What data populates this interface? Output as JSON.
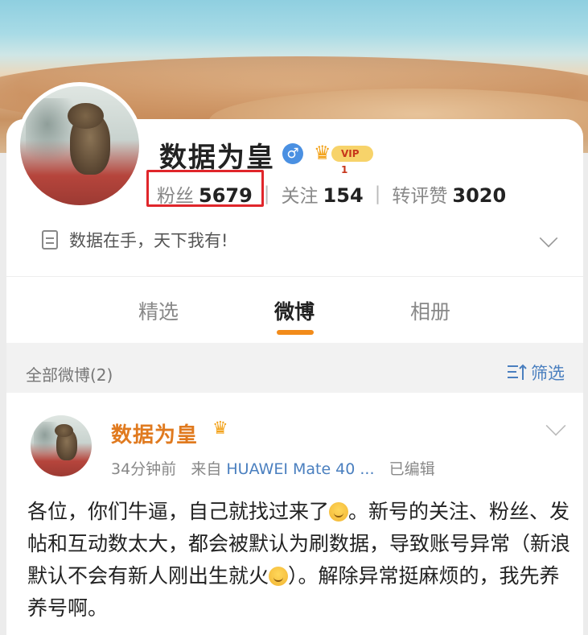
{
  "profile": {
    "username": "数据为皇",
    "gender_symbol": "♂",
    "vip_label": "VIP 1",
    "stats": [
      {
        "label": "粉丝",
        "value": "5679"
      },
      {
        "label": "关注",
        "value": "154"
      },
      {
        "label": "转评赞",
        "value": "3020"
      }
    ],
    "bio": "数据在手，天下我有!"
  },
  "tabs": [
    {
      "label": "精选",
      "active": false
    },
    {
      "label": "微博",
      "active": true
    },
    {
      "label": "相册",
      "active": false
    }
  ],
  "filter_bar": {
    "count_label": "全部微博(2)",
    "filter_label": "筛选"
  },
  "post": {
    "author": "数据为皇",
    "time": "34分钟前",
    "source_prefix": "来自",
    "device": "HUAWEI Mate 40 ...",
    "edited": "已编辑",
    "body_part1": "各位，你们牛逼，自己就找过来了",
    "body_part2": "。新号的关注、粉丝、发帖和互动数太大，都会被默认为刷数据，导致账号异常（新浪默认不会有新人刚出生就火",
    "body_part3": "）。解除异常挺麻烦的，我先养养号啊。"
  },
  "colors": {
    "accent_orange": "#f28b1a",
    "link_blue": "#4a7fbf",
    "highlight_red": "#e0262b"
  },
  "icons": [
    "gender-male-icon",
    "vip-crown-icon",
    "document-icon",
    "chevron-down-icon",
    "filter-icon",
    "crown-icon",
    "sweat-smile-emoji-icon",
    "laugh-cry-emoji-icon"
  ]
}
